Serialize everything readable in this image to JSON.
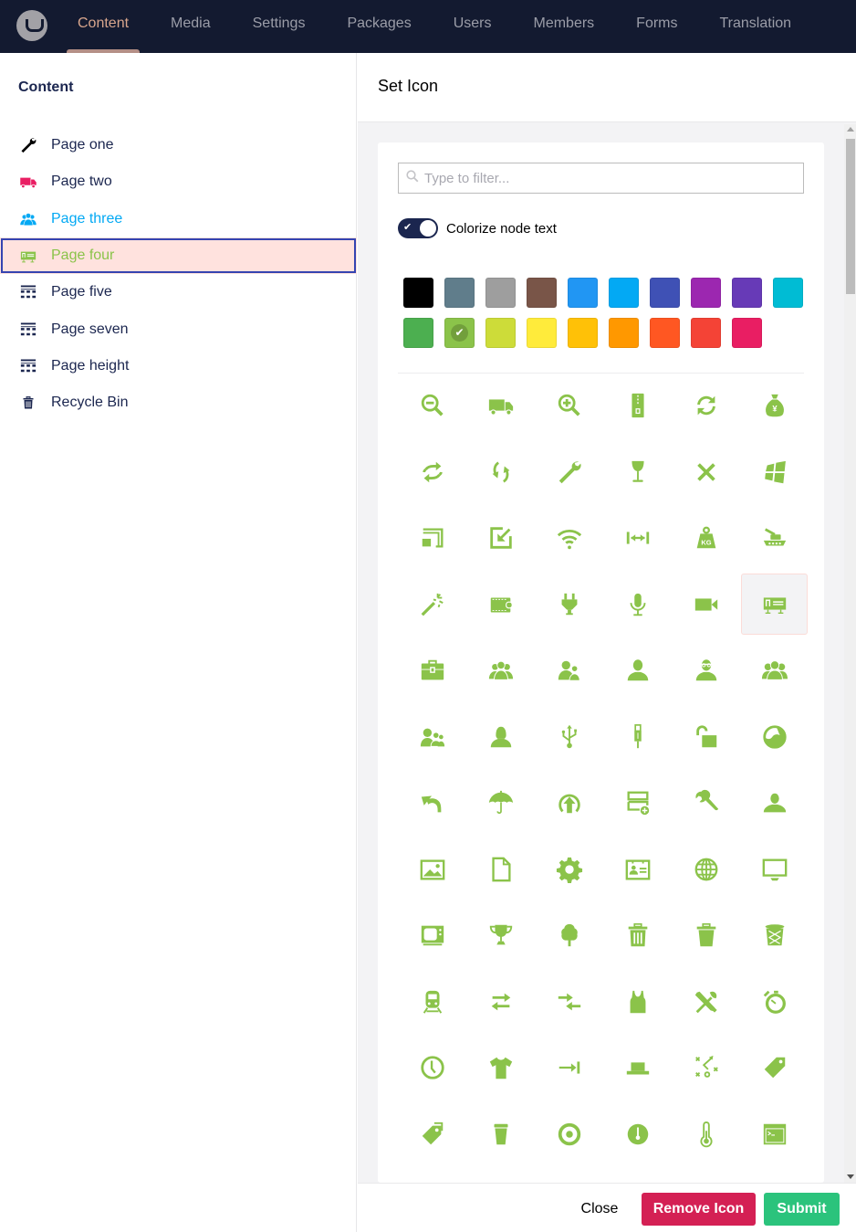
{
  "topnav": {
    "logo": "umbraco-logo-icon",
    "items": [
      {
        "label": "Content",
        "active": true
      },
      {
        "label": "Media",
        "active": false
      },
      {
        "label": "Settings",
        "active": false
      },
      {
        "label": "Packages",
        "active": false
      },
      {
        "label": "Users",
        "active": false
      },
      {
        "label": "Members",
        "active": false
      },
      {
        "label": "Forms",
        "active": false
      },
      {
        "label": "Translation",
        "active": false
      }
    ]
  },
  "sidebar": {
    "title": "Content",
    "items": [
      {
        "label": "Page one",
        "icon": "wrench-icon",
        "color": "#000000"
      },
      {
        "label": "Page two",
        "icon": "truck-icon",
        "color": "#e91e63",
        "text_color": "#1b264f"
      },
      {
        "label": "Page three",
        "icon": "users-icon",
        "color": "#03a9f4",
        "text_color": "#03a9f4"
      },
      {
        "label": "Page four",
        "icon": "id-card-icon",
        "color": "#8bc34a",
        "text_color": "#8bc34a",
        "selected": true
      },
      {
        "label": "Page five",
        "icon": "grid-icon",
        "color": "#1b264f"
      },
      {
        "label": "Page seven",
        "icon": "grid-icon",
        "color": "#1b264f"
      },
      {
        "label": "Page height",
        "icon": "grid-icon",
        "color": "#1b264f"
      },
      {
        "label": "Recycle Bin",
        "icon": "trash-icon",
        "color": "#1b264f"
      }
    ]
  },
  "dialog": {
    "title": "Set Icon",
    "filter": {
      "placeholder": "Type to filter...",
      "value": ""
    },
    "colorize": {
      "label": "Colorize node text",
      "checked": true
    },
    "colors": [
      {
        "name": "black",
        "hex": "#000000"
      },
      {
        "name": "blue-grey",
        "hex": "#607d8b"
      },
      {
        "name": "grey",
        "hex": "#9e9e9e"
      },
      {
        "name": "brown",
        "hex": "#795548"
      },
      {
        "name": "blue",
        "hex": "#2196f3"
      },
      {
        "name": "light-blue",
        "hex": "#03a9f4"
      },
      {
        "name": "indigo",
        "hex": "#3f51b5"
      },
      {
        "name": "purple",
        "hex": "#9c27b0"
      },
      {
        "name": "deep-purple",
        "hex": "#673ab7"
      },
      {
        "name": "cyan",
        "hex": "#00bcd4"
      },
      {
        "name": "green",
        "hex": "#4caf50"
      },
      {
        "name": "light-green",
        "hex": "#8bc34a",
        "selected": true
      },
      {
        "name": "lime",
        "hex": "#cddc39"
      },
      {
        "name": "yellow",
        "hex": "#ffeb3b"
      },
      {
        "name": "amber",
        "hex": "#ffc107"
      },
      {
        "name": "orange",
        "hex": "#ff9800"
      },
      {
        "name": "deep-orange",
        "hex": "#ff5722"
      },
      {
        "name": "red",
        "hex": "#f44336"
      },
      {
        "name": "pink",
        "hex": "#e91e63"
      }
    ],
    "icon_color": "#8bc34a",
    "icons": [
      "zoom-out-icon",
      "truck-icon",
      "zoom-in-icon",
      "zip-icon",
      "sync-icon",
      "money-bag-icon",
      "repeat-icon",
      "refresh-icon",
      "wrench-icon",
      "wine-glass-icon",
      "close-icon",
      "windows-icon",
      "cast-icon",
      "shrink-icon",
      "wifi-icon",
      "width-icon",
      "weight-icon",
      "tank-icon",
      "magic-wand-icon",
      "wallet-icon",
      "plug-icon",
      "microphone-icon",
      "video-camera-icon",
      "id-card-icon",
      "toolbox-icon",
      "users-icon",
      "users-alt-icon",
      "user-icon",
      "user-glasses-icon",
      "users-group-icon",
      "user-females-icon",
      "user-female-icon",
      "usb-icon",
      "usb-connector-icon",
      "unlocked-icon",
      "yin-yang-icon",
      "undo-icon",
      "umbrella-icon",
      "upload-icon",
      "add-row-icon",
      "tools-icon",
      "user-alt-icon",
      "picture-icon",
      "document-icon",
      "settings-icon",
      "contact-card-icon",
      "globe-icon",
      "display-icon",
      "tv-old-icon",
      "trophy-icon",
      "tree-icon",
      "trash-icon",
      "trash-alt-icon",
      "recycle-bin-icon",
      "train-icon",
      "exchange-icon",
      "transfer-icon",
      "tank-top-icon",
      "tools-cross-icon",
      "stopwatch-icon",
      "clock-icon",
      "t-shirt-icon",
      "tab-key-icon",
      "hat-icon",
      "strategy-icon",
      "tag-icon",
      "tags-icon",
      "coffee-cup-icon",
      "target-icon",
      "dashboard-icon",
      "thermometer-icon",
      "terminal-icon"
    ],
    "selected_icon": "id-card-icon",
    "buttons": {
      "close": "Close",
      "remove": "Remove Icon",
      "submit": "Submit"
    }
  }
}
